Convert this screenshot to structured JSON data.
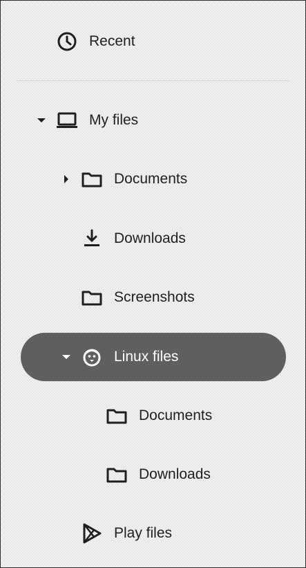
{
  "nav": {
    "recent": {
      "label": "Recent",
      "icon": "clock-icon"
    },
    "my_files": {
      "label": "My files",
      "icon": "laptop-icon",
      "expanded": true
    },
    "documents": {
      "label": "Documents",
      "icon": "folder-icon",
      "expanded": false
    },
    "downloads": {
      "label": "Downloads",
      "icon": "download-icon"
    },
    "screenshots": {
      "label": "Screenshots",
      "icon": "folder-icon"
    },
    "linux_files": {
      "label": "Linux files",
      "icon": "penguin-icon",
      "expanded": true,
      "selected": true
    },
    "linux_documents": {
      "label": "Documents",
      "icon": "folder-icon"
    },
    "linux_downloads": {
      "label": "Downloads",
      "icon": "folder-icon"
    },
    "play_files": {
      "label": "Play files",
      "icon": "play-store-icon"
    }
  },
  "colors": {
    "text": "#1f1f1f",
    "selected_bg": "#5f5f5f",
    "selected_text": "#ffffff",
    "divider": "#d6d6d6"
  }
}
